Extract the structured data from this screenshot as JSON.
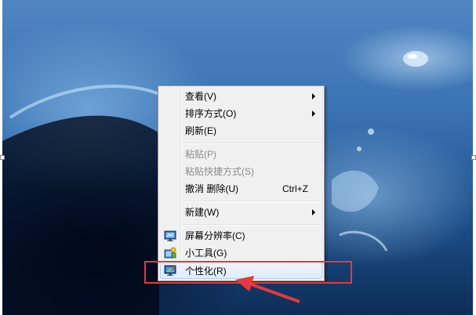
{
  "context_menu": {
    "items": [
      {
        "label": "查看(V)",
        "submenu": true
      },
      {
        "label": "排序方式(O)",
        "submenu": true
      },
      {
        "label": "刷新(E)"
      },
      {
        "label": "粘贴(P)",
        "disabled": true
      },
      {
        "label": "粘贴快捷方式(S)",
        "disabled": true
      },
      {
        "label": "撤消 删除(U)",
        "shortcut": "Ctrl+Z"
      },
      {
        "label": "新建(W)",
        "submenu": true
      },
      {
        "label": "屏幕分辨率(C)",
        "icon": "screen-resolution-icon"
      },
      {
        "label": "小工具(G)",
        "icon": "gadgets-icon"
      },
      {
        "label": "个性化(R)",
        "icon": "personalize-icon",
        "highlighted": true
      }
    ]
  },
  "annotation": {
    "color": "#e5393b",
    "target": "个性化(R)"
  }
}
